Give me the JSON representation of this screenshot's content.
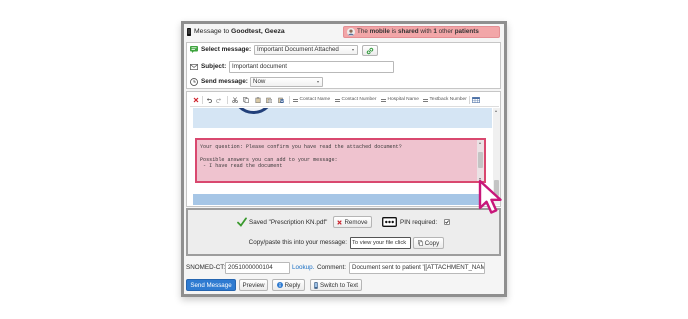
{
  "window": {
    "icon": "mobile-phone-icon",
    "recipient_prefix": "Message to",
    "recipient_name": "Goodtest, Geeza"
  },
  "shared_alert": {
    "icon": "user-avatar-icon",
    "segments": [
      {
        "text": "The",
        "bold": false
      },
      {
        "text": "mobile",
        "bold": true
      },
      {
        "text": "is",
        "bold": false
      },
      {
        "text": "shared",
        "bold": true
      },
      {
        "text": "with",
        "bold": false
      },
      {
        "text": "1",
        "bold": true
      },
      {
        "text": "other",
        "bold": false
      },
      {
        "text": "patients",
        "bold": true
      }
    ]
  },
  "compose": {
    "select_message": {
      "icon": "message-template-icon",
      "label": "Select message:",
      "selected": "Important Document Attached",
      "action_icon": "link-icon"
    },
    "subject": {
      "icon": "envelope-icon",
      "label": "Subject:",
      "value": "Important document"
    },
    "send_message": {
      "icon": "clock-icon",
      "label": "Send message:",
      "selected": "Now"
    }
  },
  "editor": {
    "toolbar": {
      "buttons": [
        "clear-formatting-icon",
        "undo-icon",
        "redo-icon",
        "cut-icon",
        "copy-icon",
        "paste-icon",
        "paste-text-icon",
        "paste-word-icon"
      ],
      "placeholders": [
        {
          "icon": "insert-field-icon",
          "label": "Contact Name"
        },
        {
          "icon": "insert-field-icon",
          "label": "Contact Number"
        },
        {
          "icon": "insert-field-icon",
          "label": "Hospital Name"
        },
        {
          "icon": "insert-field-icon",
          "label": "Textback Number"
        }
      ],
      "table_icon": "table-icon"
    },
    "question_box": {
      "question": "Your question: Please confirm you have read the attached document?",
      "answers_heading": "Possible answers you can add to your message:",
      "answers": [
        "- I have read the document"
      ]
    }
  },
  "attachment": {
    "status_icon": "check-icon",
    "status": "Saved \"Prescription KN.pdf\"",
    "remove_icon": "remove-icon",
    "remove_label": "Remove",
    "pin_icon": "password-icon",
    "pin_label": "PIN required:",
    "pin_required": true,
    "copy_label": "Copy/paste this into your message:",
    "copy_value": "To view your file click",
    "copy_button_icon": "copy-icon",
    "copy_button_label": "Copy"
  },
  "coding": {
    "snomed_label": "SNOMED-CT:",
    "snomed_value": "2051000000104",
    "lookup_label": "Lookup.",
    "comment_label": "Comment:",
    "comment_value": "Document sent to patient '[[ATTACHMENT_NAME"
  },
  "actions": {
    "send_label": "Send Message",
    "preview_label": "Preview",
    "reply_icon": "info-icon",
    "reply_label": "Reply",
    "switch_icon": "mobile-phone-icon",
    "switch_label": "Switch to Text"
  },
  "cursor_icon": "mouse-pointer-icon",
  "colors": {
    "primary": "#2f7bd1",
    "link": "#1a6fc4",
    "alert": "#f2a6a8",
    "question_border": "#d9486f",
    "question_background": "#efc3cf",
    "cursor": "#c8177a"
  }
}
